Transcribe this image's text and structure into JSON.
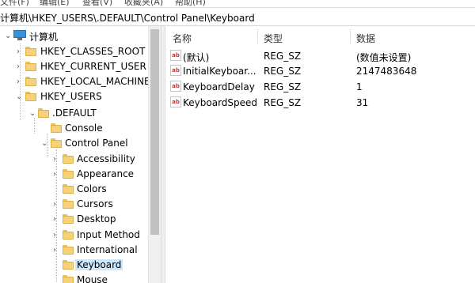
{
  "menu": [
    "文件(F)",
    "编辑(E)",
    "查看(V)",
    "收藏夹(A)",
    "帮助(H)"
  ],
  "address": "计算机\\HKEY_USERS\\.DEFAULT\\Control Panel\\Keyboard",
  "tree": {
    "root": "计算机",
    "hives": [
      "HKEY_CLASSES_ROOT",
      "HKEY_CURRENT_USER",
      "HKEY_LOCAL_MACHINE",
      "HKEY_USERS"
    ],
    "default_key": ".DEFAULT",
    "console": "Console",
    "control_panel": "Control Panel",
    "control_panel_children": [
      "Accessibility",
      "Appearance",
      "Colors",
      "Cursors",
      "Desktop",
      "Input Method",
      "International",
      "Keyboard",
      "Mouse"
    ]
  },
  "columns": {
    "name": "名称",
    "type": "类型",
    "data": "数据"
  },
  "values": [
    {
      "name": "(默认)",
      "type": "REG_SZ",
      "data": "(数值未设置)",
      "icon": "ab"
    },
    {
      "name": "InitialKeyboar...",
      "type": "REG_SZ",
      "data": "2147483648",
      "icon": "ab"
    },
    {
      "name": "KeyboardDelay",
      "type": "REG_SZ",
      "data": "1",
      "icon": "ab"
    },
    {
      "name": "KeyboardSpeed",
      "type": "REG_SZ",
      "data": "31",
      "icon": "ab"
    }
  ]
}
